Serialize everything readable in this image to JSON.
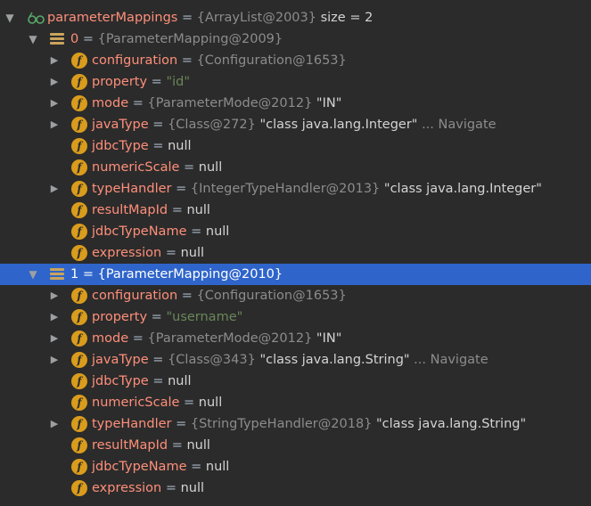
{
  "root": {
    "name": "parameterMappings",
    "eq": " = ",
    "ref": "{ArrayList@2003}",
    "extra": "  size = 2"
  },
  "items": [
    {
      "name": "0",
      "eq": " = ",
      "ref": "{ParameterMapping@2009}",
      "fields": [
        {
          "name": "configuration",
          "eq": " = ",
          "ref": "{Configuration@1653}",
          "val": "",
          "nav": "",
          "expandable": true
        },
        {
          "name": "property",
          "eq": " = ",
          "ref": "",
          "str": "\"id\"",
          "val": "",
          "nav": "",
          "expandable": true
        },
        {
          "name": "mode",
          "eq": " = ",
          "ref": "{ParameterMode@2012}",
          "val": " \"IN\"",
          "nav": "",
          "expandable": true
        },
        {
          "name": "javaType",
          "eq": " = ",
          "ref": "{Class@272}",
          "val": " \"class java.lang.Integer\"",
          "nav": " ... Navigate",
          "expandable": true
        },
        {
          "name": "jdbcType",
          "eq": " = ",
          "ref": "",
          "val": "null",
          "nav": "",
          "expandable": false
        },
        {
          "name": "numericScale",
          "eq": " = ",
          "ref": "",
          "val": "null",
          "nav": "",
          "expandable": false
        },
        {
          "name": "typeHandler",
          "eq": " = ",
          "ref": "{IntegerTypeHandler@2013}",
          "val": " \"class java.lang.Integer\"",
          "nav": "",
          "expandable": true
        },
        {
          "name": "resultMapId",
          "eq": " = ",
          "ref": "",
          "val": "null",
          "nav": "",
          "expandable": false
        },
        {
          "name": "jdbcTypeName",
          "eq": " = ",
          "ref": "",
          "val": "null",
          "nav": "",
          "expandable": false
        },
        {
          "name": "expression",
          "eq": " = ",
          "ref": "",
          "val": "null",
          "nav": "",
          "expandable": false
        }
      ]
    },
    {
      "name": "1",
      "eq": " = ",
      "ref": "{ParameterMapping@2010}",
      "fields": [
        {
          "name": "configuration",
          "eq": " = ",
          "ref": "{Configuration@1653}",
          "val": "",
          "nav": "",
          "expandable": true
        },
        {
          "name": "property",
          "eq": " = ",
          "ref": "",
          "str": "\"username\"",
          "val": "",
          "nav": "",
          "expandable": true
        },
        {
          "name": "mode",
          "eq": " = ",
          "ref": "{ParameterMode@2012}",
          "val": " \"IN\"",
          "nav": "",
          "expandable": true
        },
        {
          "name": "javaType",
          "eq": " = ",
          "ref": "{Class@343}",
          "val": " \"class java.lang.String\"",
          "nav": " ... Navigate",
          "expandable": true
        },
        {
          "name": "jdbcType",
          "eq": " = ",
          "ref": "",
          "val": "null",
          "nav": "",
          "expandable": false
        },
        {
          "name": "numericScale",
          "eq": " = ",
          "ref": "",
          "val": "null",
          "nav": "",
          "expandable": false
        },
        {
          "name": "typeHandler",
          "eq": " = ",
          "ref": "{StringTypeHandler@2018}",
          "val": " \"class java.lang.String\"",
          "nav": "",
          "expandable": true
        },
        {
          "name": "resultMapId",
          "eq": " = ",
          "ref": "",
          "val": "null",
          "nav": "",
          "expandable": false
        },
        {
          "name": "jdbcTypeName",
          "eq": " = ",
          "ref": "",
          "val": "null",
          "nav": "",
          "expandable": false
        },
        {
          "name": "expression",
          "eq": " = ",
          "ref": "",
          "val": "null",
          "nav": "",
          "expandable": false
        }
      ]
    }
  ],
  "colors": {
    "background": "#2b2b2b",
    "selection": "#2f65ca",
    "field_name": "#ff8f7a",
    "string": "#6a8759",
    "field_icon": "#d99c1c"
  },
  "icons": {
    "root": "watch-glasses-icon",
    "item": "object-icon",
    "field": "field-f-icon",
    "expanded": "triangle-down",
    "collapsed": "triangle-right"
  }
}
